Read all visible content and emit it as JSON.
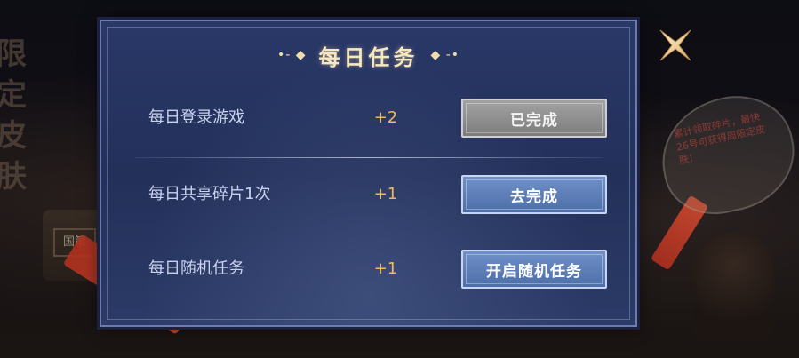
{
  "background": {
    "side_text": "限定皮肤",
    "lantern_text": "国策",
    "bubble_text": "累计领取碎片，最快26号可获得周限定皮肤！"
  },
  "dialog": {
    "title": "每日任务",
    "title_left_deco": "•- ◆",
    "title_right_deco": "◆ -•",
    "close_icon": "close-x-icon",
    "tasks": [
      {
        "name": "每日登录游戏",
        "reward": "+2",
        "button": "已完成",
        "state": "completed"
      },
      {
        "name": "每日共享碎片1次",
        "reward": "+1",
        "button": "去完成",
        "state": "available"
      },
      {
        "name": "每日随机任务",
        "reward": "+1",
        "button": "开启随机任务",
        "state": "available"
      }
    ]
  },
  "colors": {
    "panel": "#23305a",
    "reward": "#f0b85a",
    "button_done": "#8f8f8f",
    "button_active": "#5b7db8",
    "title": "#f7e7bf"
  }
}
